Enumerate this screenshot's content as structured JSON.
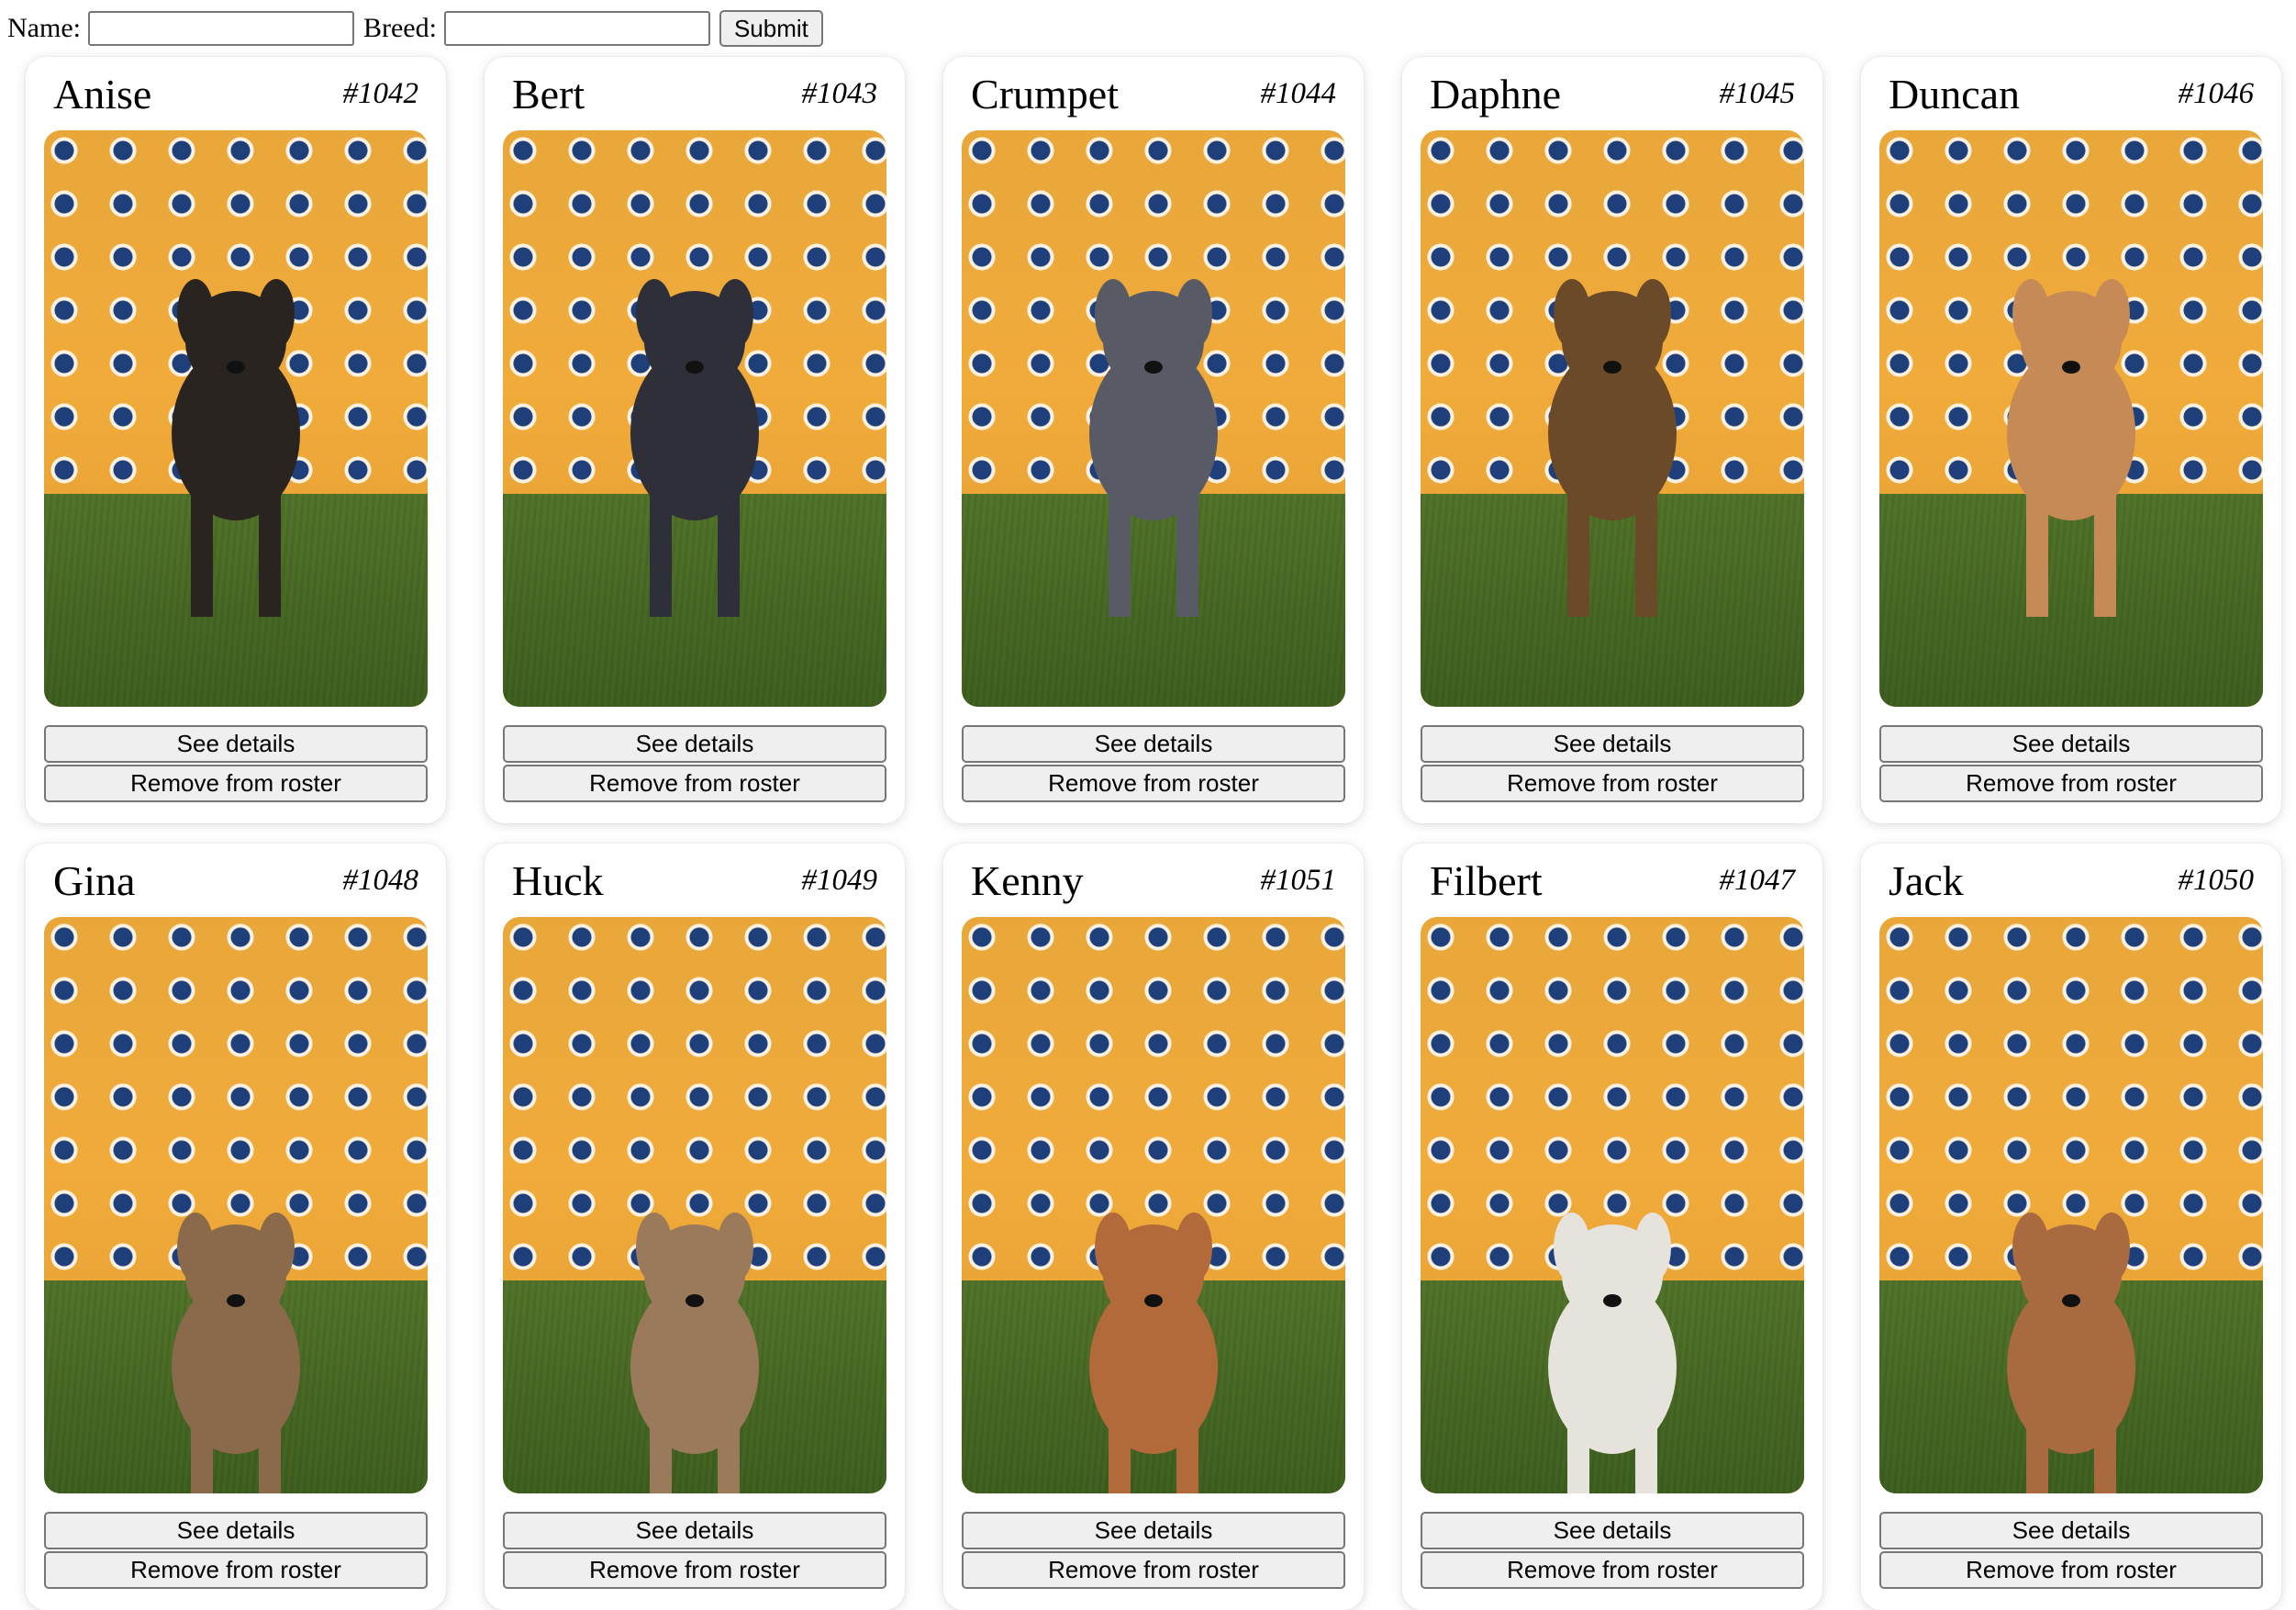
{
  "form": {
    "name_label": "Name:",
    "name_value": "",
    "breed_label": "Breed:",
    "breed_value": "",
    "submit_label": "Submit"
  },
  "cards": [
    {
      "name": "Anise",
      "number": "#1042",
      "details_label": "See details",
      "remove_label": "Remove from roster",
      "photo_icon": "puppy-photo",
      "coat": "#2a2420"
    },
    {
      "name": "Bert",
      "number": "#1043",
      "details_label": "See details",
      "remove_label": "Remove from roster",
      "photo_icon": "puppy-photo",
      "coat": "#2e2f38"
    },
    {
      "name": "Crumpet",
      "number": "#1044",
      "details_label": "See details",
      "remove_label": "Remove from roster",
      "photo_icon": "puppy-photo",
      "coat": "#585b66"
    },
    {
      "name": "Daphne",
      "number": "#1045",
      "details_label": "See details",
      "remove_label": "Remove from roster",
      "photo_icon": "puppy-photo",
      "coat": "#6b4a2a"
    },
    {
      "name": "Duncan",
      "number": "#1046",
      "details_label": "See details",
      "remove_label": "Remove from roster",
      "photo_icon": "puppy-photo",
      "coat": "#c58a55"
    },
    {
      "name": "Gina",
      "number": "#1048",
      "details_label": "See details",
      "remove_label": "Remove from roster",
      "photo_icon": "puppy-photo",
      "coat": "#8a6a4a"
    },
    {
      "name": "Huck",
      "number": "#1049",
      "details_label": "See details",
      "remove_label": "Remove from roster",
      "photo_icon": "puppy-photo",
      "coat": "#9a7a5a"
    },
    {
      "name": "Kenny",
      "number": "#1051",
      "details_label": "See details",
      "remove_label": "Remove from roster",
      "photo_icon": "puppy-photo",
      "coat": "#b36a3a"
    },
    {
      "name": "Filbert",
      "number": "#1047",
      "details_label": "See details",
      "remove_label": "Remove from roster",
      "photo_icon": "puppy-photo",
      "coat": "#e6e2dc"
    },
    {
      "name": "Jack",
      "number": "#1050",
      "details_label": "See details",
      "remove_label": "Remove from roster",
      "photo_icon": "puppy-photo",
      "coat": "#a86a3e"
    }
  ],
  "colors": {
    "backdrop": "#f0ab3a",
    "backdrop_logo": "#1f3f7a",
    "turf": "#4a6b25",
    "button_bg": "#efefef",
    "button_border": "#767676"
  }
}
